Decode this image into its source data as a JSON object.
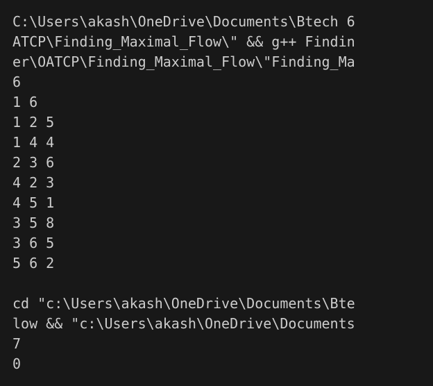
{
  "terminal": {
    "lines": [
      "C:\\Users\\akash\\OneDrive\\Documents\\Btech 6",
      "ATCP\\Finding_Maximal_Flow\\\" && g++ Findin",
      "er\\OATCP\\Finding_Maximal_Flow\\\"Finding_Ma",
      "6",
      "1 6",
      "1 2 5",
      "1 4 4",
      "2 3 6",
      "4 2 3",
      "4 5 1",
      "3 5 8",
      "3 6 5",
      "5 6 2",
      "",
      "cd \"c:\\Users\\akash\\OneDrive\\Documents\\Bte",
      "low && \"c:\\Users\\akash\\OneDrive\\Documents",
      "7",
      "0"
    ]
  },
  "colors": {
    "background": "#181818",
    "text": "#cccccc"
  }
}
